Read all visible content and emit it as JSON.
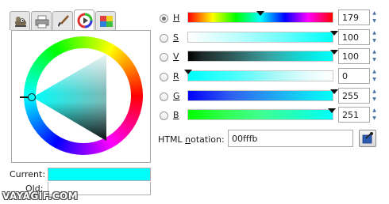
{
  "tabs": [
    {
      "name": "gimp-icon"
    },
    {
      "name": "printer-icon"
    },
    {
      "name": "paintbrush-icon"
    },
    {
      "name": "color-wheel-icon"
    },
    {
      "name": "palette-icon"
    }
  ],
  "channels": [
    {
      "key": "H",
      "value": "179",
      "checked": true
    },
    {
      "key": "S",
      "value": "100",
      "checked": false
    },
    {
      "key": "V",
      "value": "100",
      "checked": false
    },
    {
      "key": "R",
      "value": "0",
      "checked": false
    },
    {
      "key": "G",
      "value": "255",
      "checked": false
    },
    {
      "key": "B",
      "value": "251",
      "checked": false
    }
  ],
  "html_notation": {
    "label_prefix": "HTML ",
    "label_underlined": "n",
    "label_suffix": "otation:",
    "value": "00fffb"
  },
  "current_label": "Current:",
  "old_label": "Old:",
  "current_color": "#00fffb",
  "watermark": "VAYAGIF.COM"
}
